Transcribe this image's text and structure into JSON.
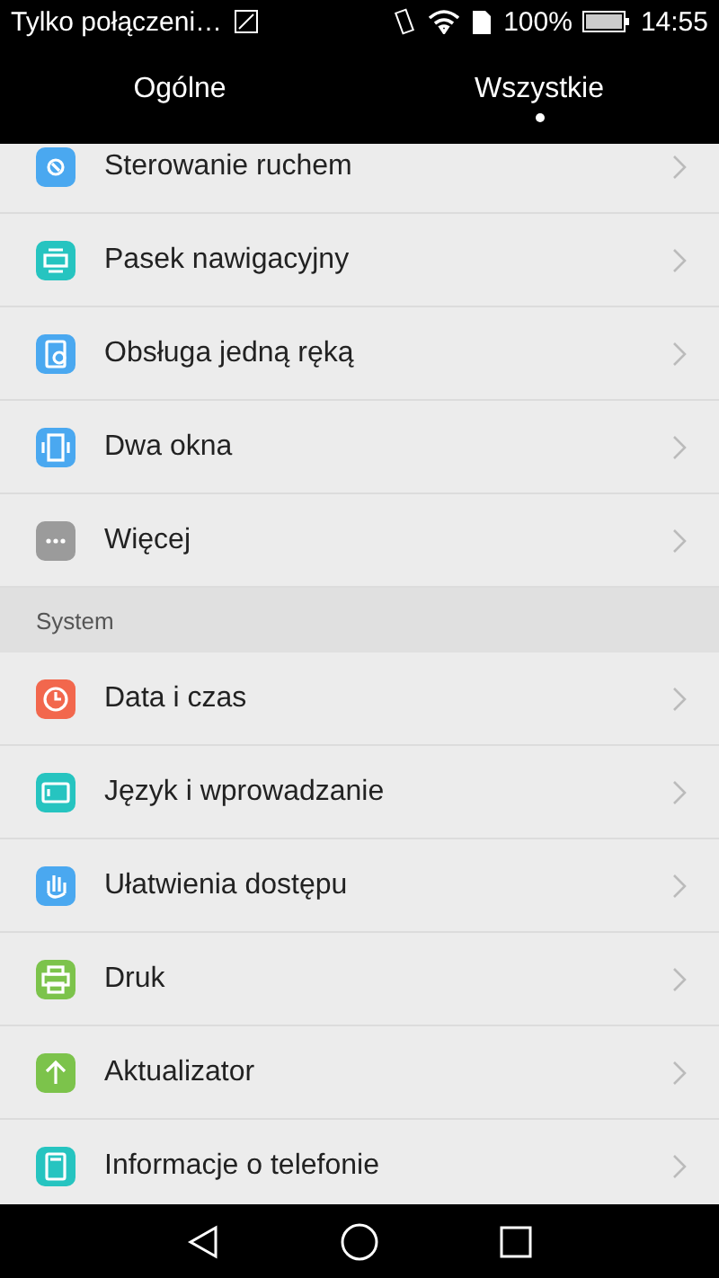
{
  "status_bar": {
    "carrier": "Tylko połączeni…",
    "battery_text": "100%",
    "time": "14:55"
  },
  "tabs": [
    {
      "label": "Ogólne",
      "selected": false
    },
    {
      "label": "Wszystkie",
      "selected": true
    }
  ],
  "sections": [
    {
      "items": [
        {
          "label": "Sterowanie ruchem",
          "kind": "motion",
          "color": "#4aa8f0"
        },
        {
          "label": "Pasek nawigacyjny",
          "kind": "navbar",
          "color": "#26c4c0"
        },
        {
          "label": "Obsługa jedną ręką",
          "kind": "onehand",
          "color": "#4aa8f0"
        },
        {
          "label": "Dwa okna",
          "kind": "split",
          "color": "#4aa8f0"
        },
        {
          "label": "Więcej",
          "kind": "more",
          "color": "#9b9b9b"
        }
      ]
    },
    {
      "title": "System",
      "items": [
        {
          "label": "Data i czas",
          "kind": "clock",
          "color": "#f2674d"
        },
        {
          "label": "Język i wprowadzanie",
          "kind": "keyboard",
          "color": "#26c4c0"
        },
        {
          "label": "Ułatwienia dostępu",
          "kind": "hand",
          "color": "#4aa8f0"
        },
        {
          "label": "Druk",
          "kind": "printer",
          "color": "#7cc34b"
        },
        {
          "label": "Aktualizator",
          "kind": "update",
          "color": "#7cc34b"
        },
        {
          "label": "Informacje o telefonie",
          "kind": "phone",
          "color": "#26c4c0"
        }
      ]
    }
  ]
}
